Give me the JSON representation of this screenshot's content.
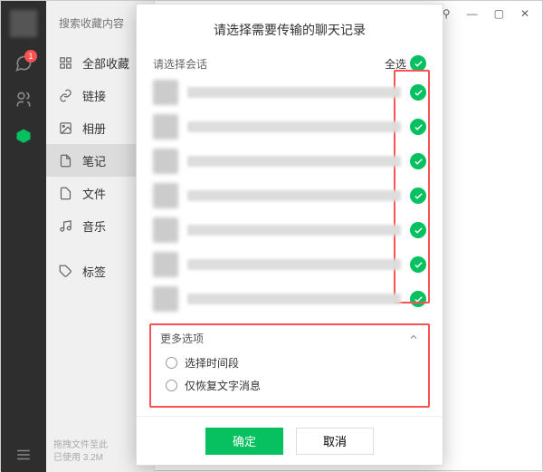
{
  "window": {
    "topbar": {
      "pin": "⚲",
      "min": "—",
      "max": "▢",
      "close": "✕"
    }
  },
  "rail": {
    "badge": "1"
  },
  "search": {
    "placeholder": "搜索收藏内容"
  },
  "categories": {
    "all": "全部收藏",
    "link": "链接",
    "album": "相册",
    "note": "笔记",
    "file": "文件",
    "music": "音乐",
    "tag": "标签"
  },
  "footer": {
    "line1": "拖拽文件至此",
    "line2": "已使用 3.2M"
  },
  "dialog": {
    "title": "请选择需要传输的聊天记录",
    "choose_label": "请选择会话",
    "select_all": "全选",
    "more": {
      "label": "更多选项",
      "opt_time": "选择时间段",
      "opt_text": "仅恢复文字消息"
    },
    "ok": "确定",
    "cancel": "取消"
  }
}
